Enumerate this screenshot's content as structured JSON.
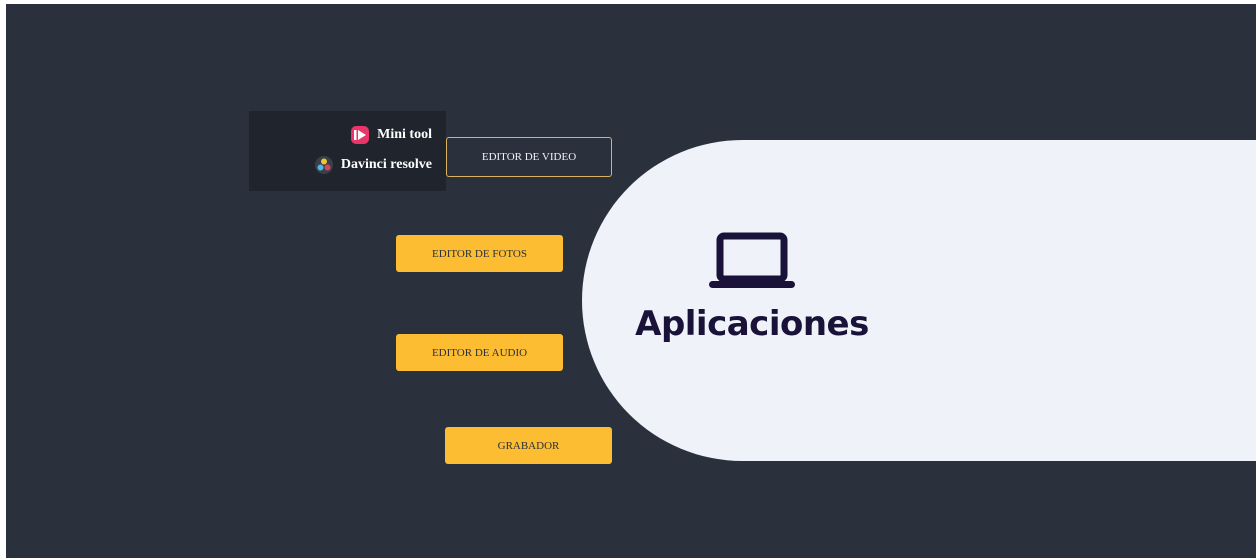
{
  "colors": {
    "background": "#2a303c",
    "panel": "#eff2f8",
    "accent": "#fcbd33",
    "title": "#1a1238",
    "dropdown": "#1f242d"
  },
  "hero": {
    "icon": "laptop-icon",
    "title": "Aplicaciones"
  },
  "buttons": {
    "video": "EDITOR DE VIDEO",
    "photos": "EDITOR DE FOTOS",
    "audio": "EDITOR DE AUDIO",
    "recorder": "GRABADOR"
  },
  "dropdown": {
    "items": [
      {
        "label": "Mini tool",
        "icon": "minitool-logo-icon"
      },
      {
        "label": "Davinci resolve",
        "icon": "davinci-resolve-logo-icon"
      }
    ]
  }
}
